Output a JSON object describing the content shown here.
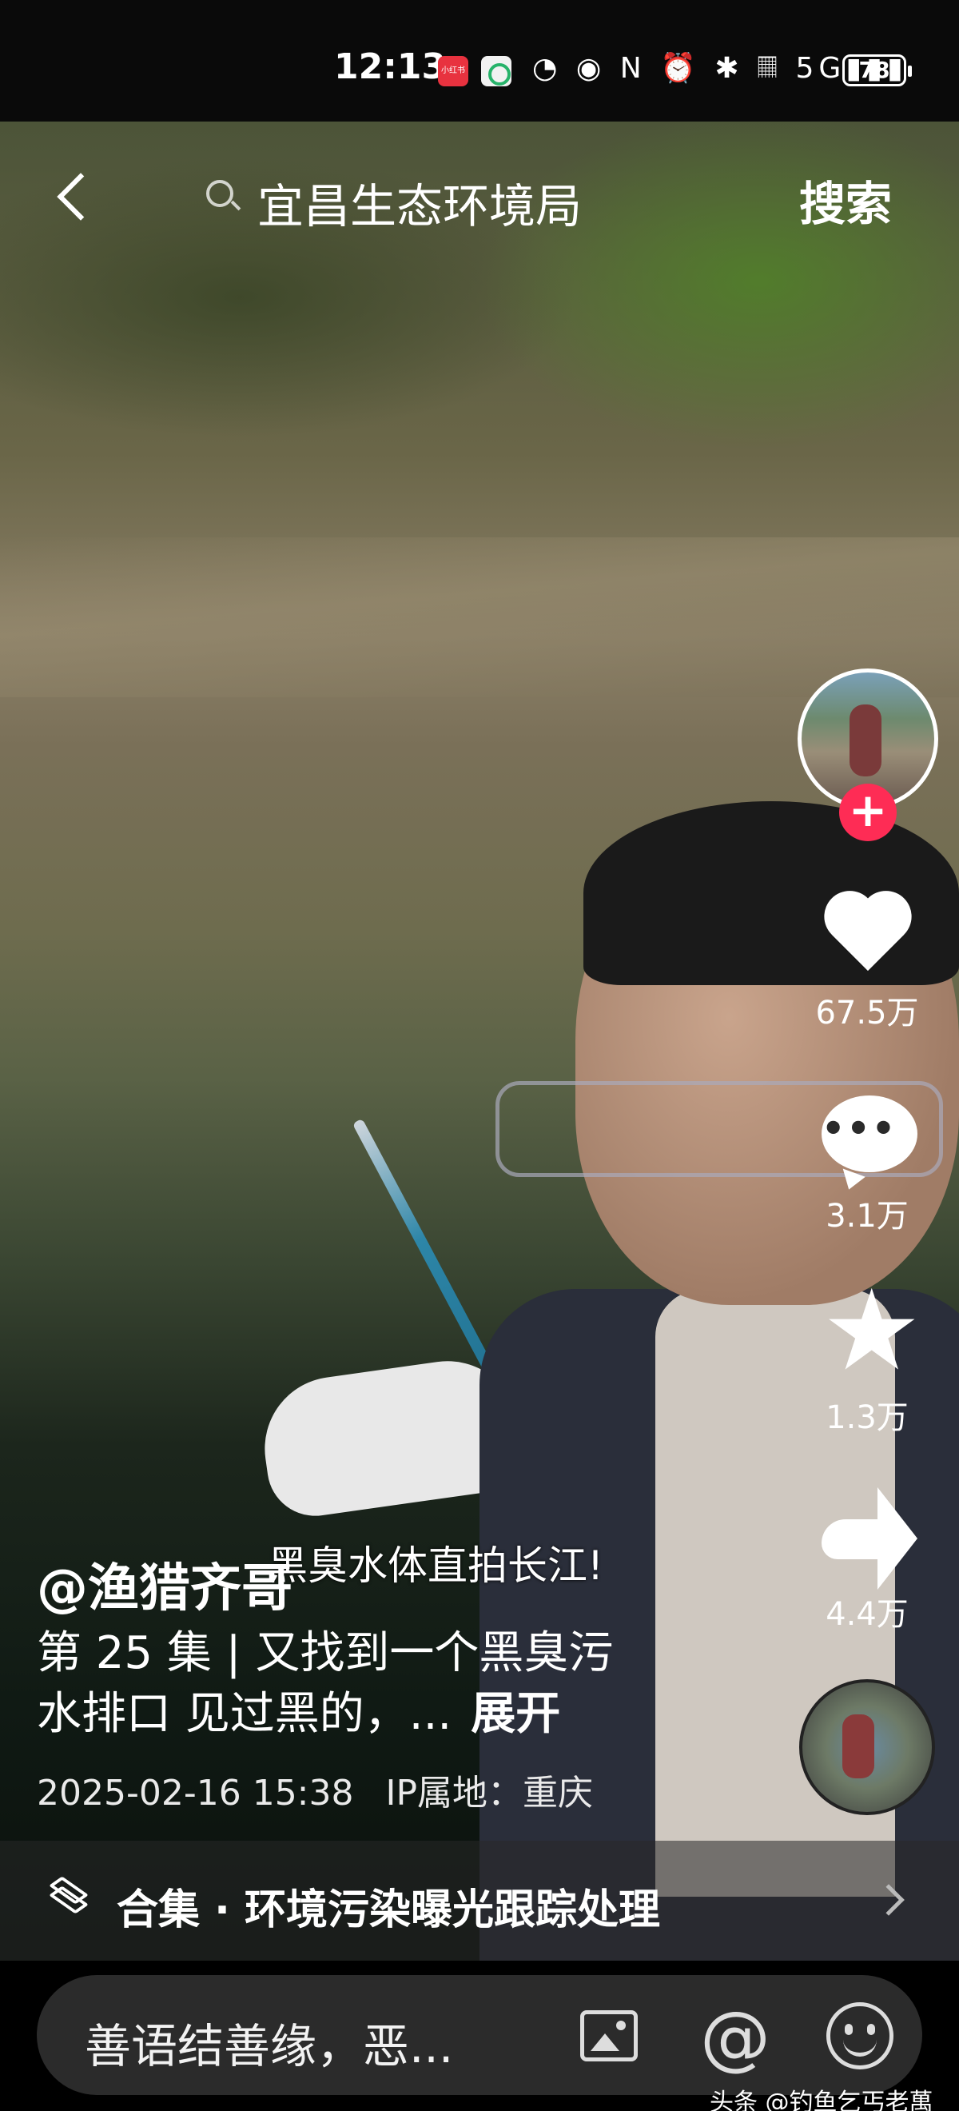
{
  "status_bar": {
    "time": "12:13",
    "badge_red_text": "小红书",
    "icons_text": "◔ ◉ N ⏰ ✱ 𝄜 5G▮▮▮",
    "battery": "78"
  },
  "search": {
    "query": "宜昌生态环境局",
    "search_button": "搜索"
  },
  "video": {
    "overlay_caption": "黑臭水体直拍长江!"
  },
  "right_rail": {
    "follow_symbol": "+",
    "likes": "67.5万",
    "comments": "3.1万",
    "favorites": "1.3万",
    "shares": "4.4万"
  },
  "post": {
    "username": "@渔猎齐哥",
    "description_line1": "第 25 集 | 又找到一个黑臭污",
    "description_line2": "水排口 见过黑的，...",
    "expand_label": "展开",
    "date": "2025-02-16 15:38",
    "ip_location": "IP属地：重庆"
  },
  "collection": {
    "label": "合集 · 环境污染曝光跟踪处理"
  },
  "comment_bar": {
    "placeholder": "善语结善缘，恶..."
  },
  "watermark": "头条 @钓鱼乞丐老萬"
}
